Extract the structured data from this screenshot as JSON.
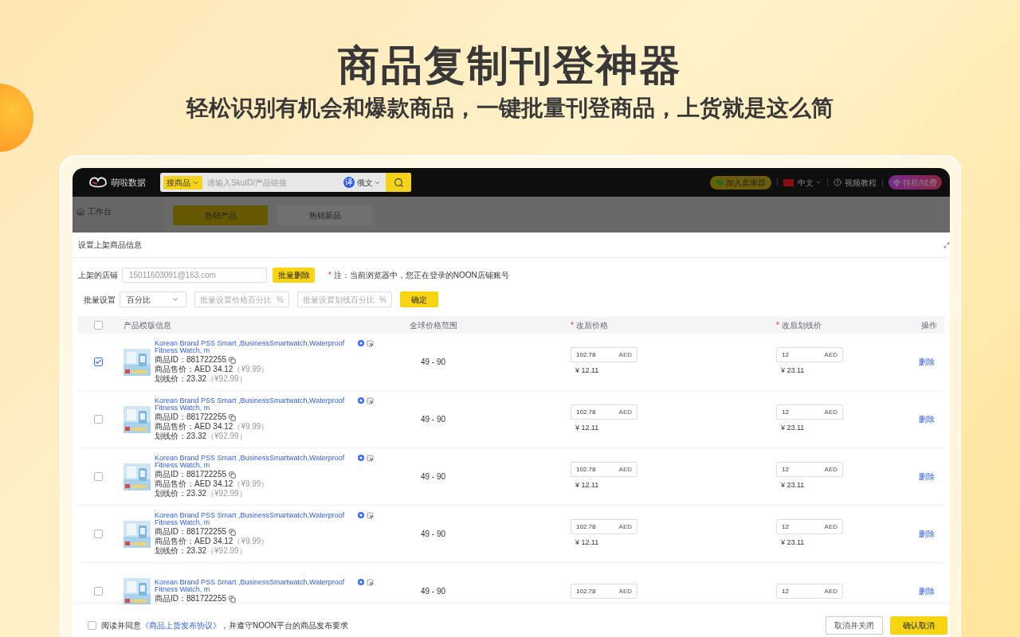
{
  "headline": "商品复制刊登神器",
  "subheadline": "轻松识别有机会和爆款商品，一键批量刊登商品，上货就是这么简",
  "app": {
    "logo": "萌啦数据",
    "search": {
      "type": "搜商品",
      "placeholder": "请输入SkuID/产品链接",
      "translate_badge": "译",
      "language": "俄文"
    },
    "join_group": "加入卖家群",
    "ui_language": "中文",
    "video_tutorial": "视频教程",
    "vip": "特权/续费",
    "sidebar": [
      {
        "label": "工作台"
      }
    ],
    "tabs": [
      {
        "label": "热销产品",
        "selected": true
      },
      {
        "label": "热销新品",
        "selected": false
      }
    ]
  },
  "modal": {
    "title": "设置上架商品信息",
    "store_label": "上架的店铺",
    "store_value": "15011603091@163.com",
    "bulk_delete": "批量删除",
    "note_mark": "*",
    "note": "注：当前浏览器中，您正在登录的NOON店铺账号",
    "bulk_label": "批量设置",
    "bulk_mode": "百分比",
    "bulk_price_placeholder": "批量设置价格百分比",
    "bulk_strike_placeholder": "批量设置划线百分比",
    "percent": "%",
    "confirm": "确定",
    "columns": [
      {
        "label": "产品模版信息",
        "required": false
      },
      {
        "label": "全球价格范围",
        "required": false
      },
      {
        "label": "改后价格",
        "required": true
      },
      {
        "label": "改后划线价",
        "required": true
      },
      {
        "label": "操作",
        "required": false
      }
    ],
    "header_checked": false,
    "rows": [
      {
        "checked": true,
        "title": "Korean Brand PSS Smart ,BusinessSmartwatch,Waterproof Fitness Watch, m",
        "id": "商品ID：881722255",
        "sale": "商品售价：AED 34.12",
        "sale_cny": "（¥9.99）",
        "strike": "划线价：23.32",
        "strike_cny": "（¥92.99）",
        "range": "49 - 90",
        "price": "102.78",
        "price_unit": "AED",
        "price_cny": "¥ 12.11",
        "strike_price": "12",
        "strike_unit": "AED",
        "strike_price_cny": "¥ 23.11",
        "action": "删除"
      },
      {
        "checked": false,
        "title": "Korean Brand PSS Smart ,BusinessSmartwatch,Waterproof Fitness Watch, m",
        "id": "商品ID：881722255",
        "sale": "商品售价：AED 34.12",
        "sale_cny": "（¥9.99）",
        "strike": "划线价：23.32",
        "strike_cny": "（¥92.99）",
        "range": "49 - 90",
        "price": "102.78",
        "price_unit": "AED",
        "price_cny": "¥ 12.11",
        "strike_price": "12",
        "strike_unit": "AED",
        "strike_price_cny": "¥ 23.11",
        "action": "删除"
      },
      {
        "checked": false,
        "title": "Korean Brand PSS Smart ,BusinessSmartwatch,Waterproof Fitness Watch, m",
        "id": "商品ID：881722255",
        "sale": "商品售价：AED 34.12",
        "sale_cny": "（¥9.99）",
        "strike": "划线价：23.32",
        "strike_cny": "（¥92.99）",
        "range": "49 - 90",
        "price": "102.78",
        "price_unit": "AED",
        "price_cny": "¥ 12.11",
        "strike_price": "12",
        "strike_unit": "AED",
        "strike_price_cny": "¥ 23.11",
        "action": "删除"
      },
      {
        "checked": false,
        "title": "Korean Brand PSS Smart ,BusinessSmartwatch,Waterproof Fitness Watch, m",
        "id": "商品ID：881722255",
        "sale": "商品售价：AED 34.12",
        "sale_cny": "（¥9.99）",
        "strike": "划线价：23.32",
        "strike_cny": "（¥92.99）",
        "range": "49 - 90",
        "price": "102.78",
        "price_unit": "AED",
        "price_cny": "¥ 12.11",
        "strike_price": "12",
        "strike_unit": "AED",
        "strike_price_cny": "¥ 23.11",
        "action": "删除"
      },
      {
        "checked": false,
        "title": "Korean Brand PSS Smart ,BusinessSmartwatch,Waterproof Fitness Watch, m",
        "id": "商品ID：881722255",
        "range": "49 - 90",
        "price": "102.78",
        "price_unit": "AED",
        "strike_price": "12",
        "strike_unit": "AED",
        "action": "删除"
      }
    ],
    "agree_checked": false,
    "agree_prefix": "阅读并同意",
    "agree_link": "《商品上货发布协议》",
    "agree_suffix": "，并遵守NOON平台的商品发布要求",
    "cancel_close": "取消并关闭",
    "confirm_cancel": "确认取消"
  }
}
